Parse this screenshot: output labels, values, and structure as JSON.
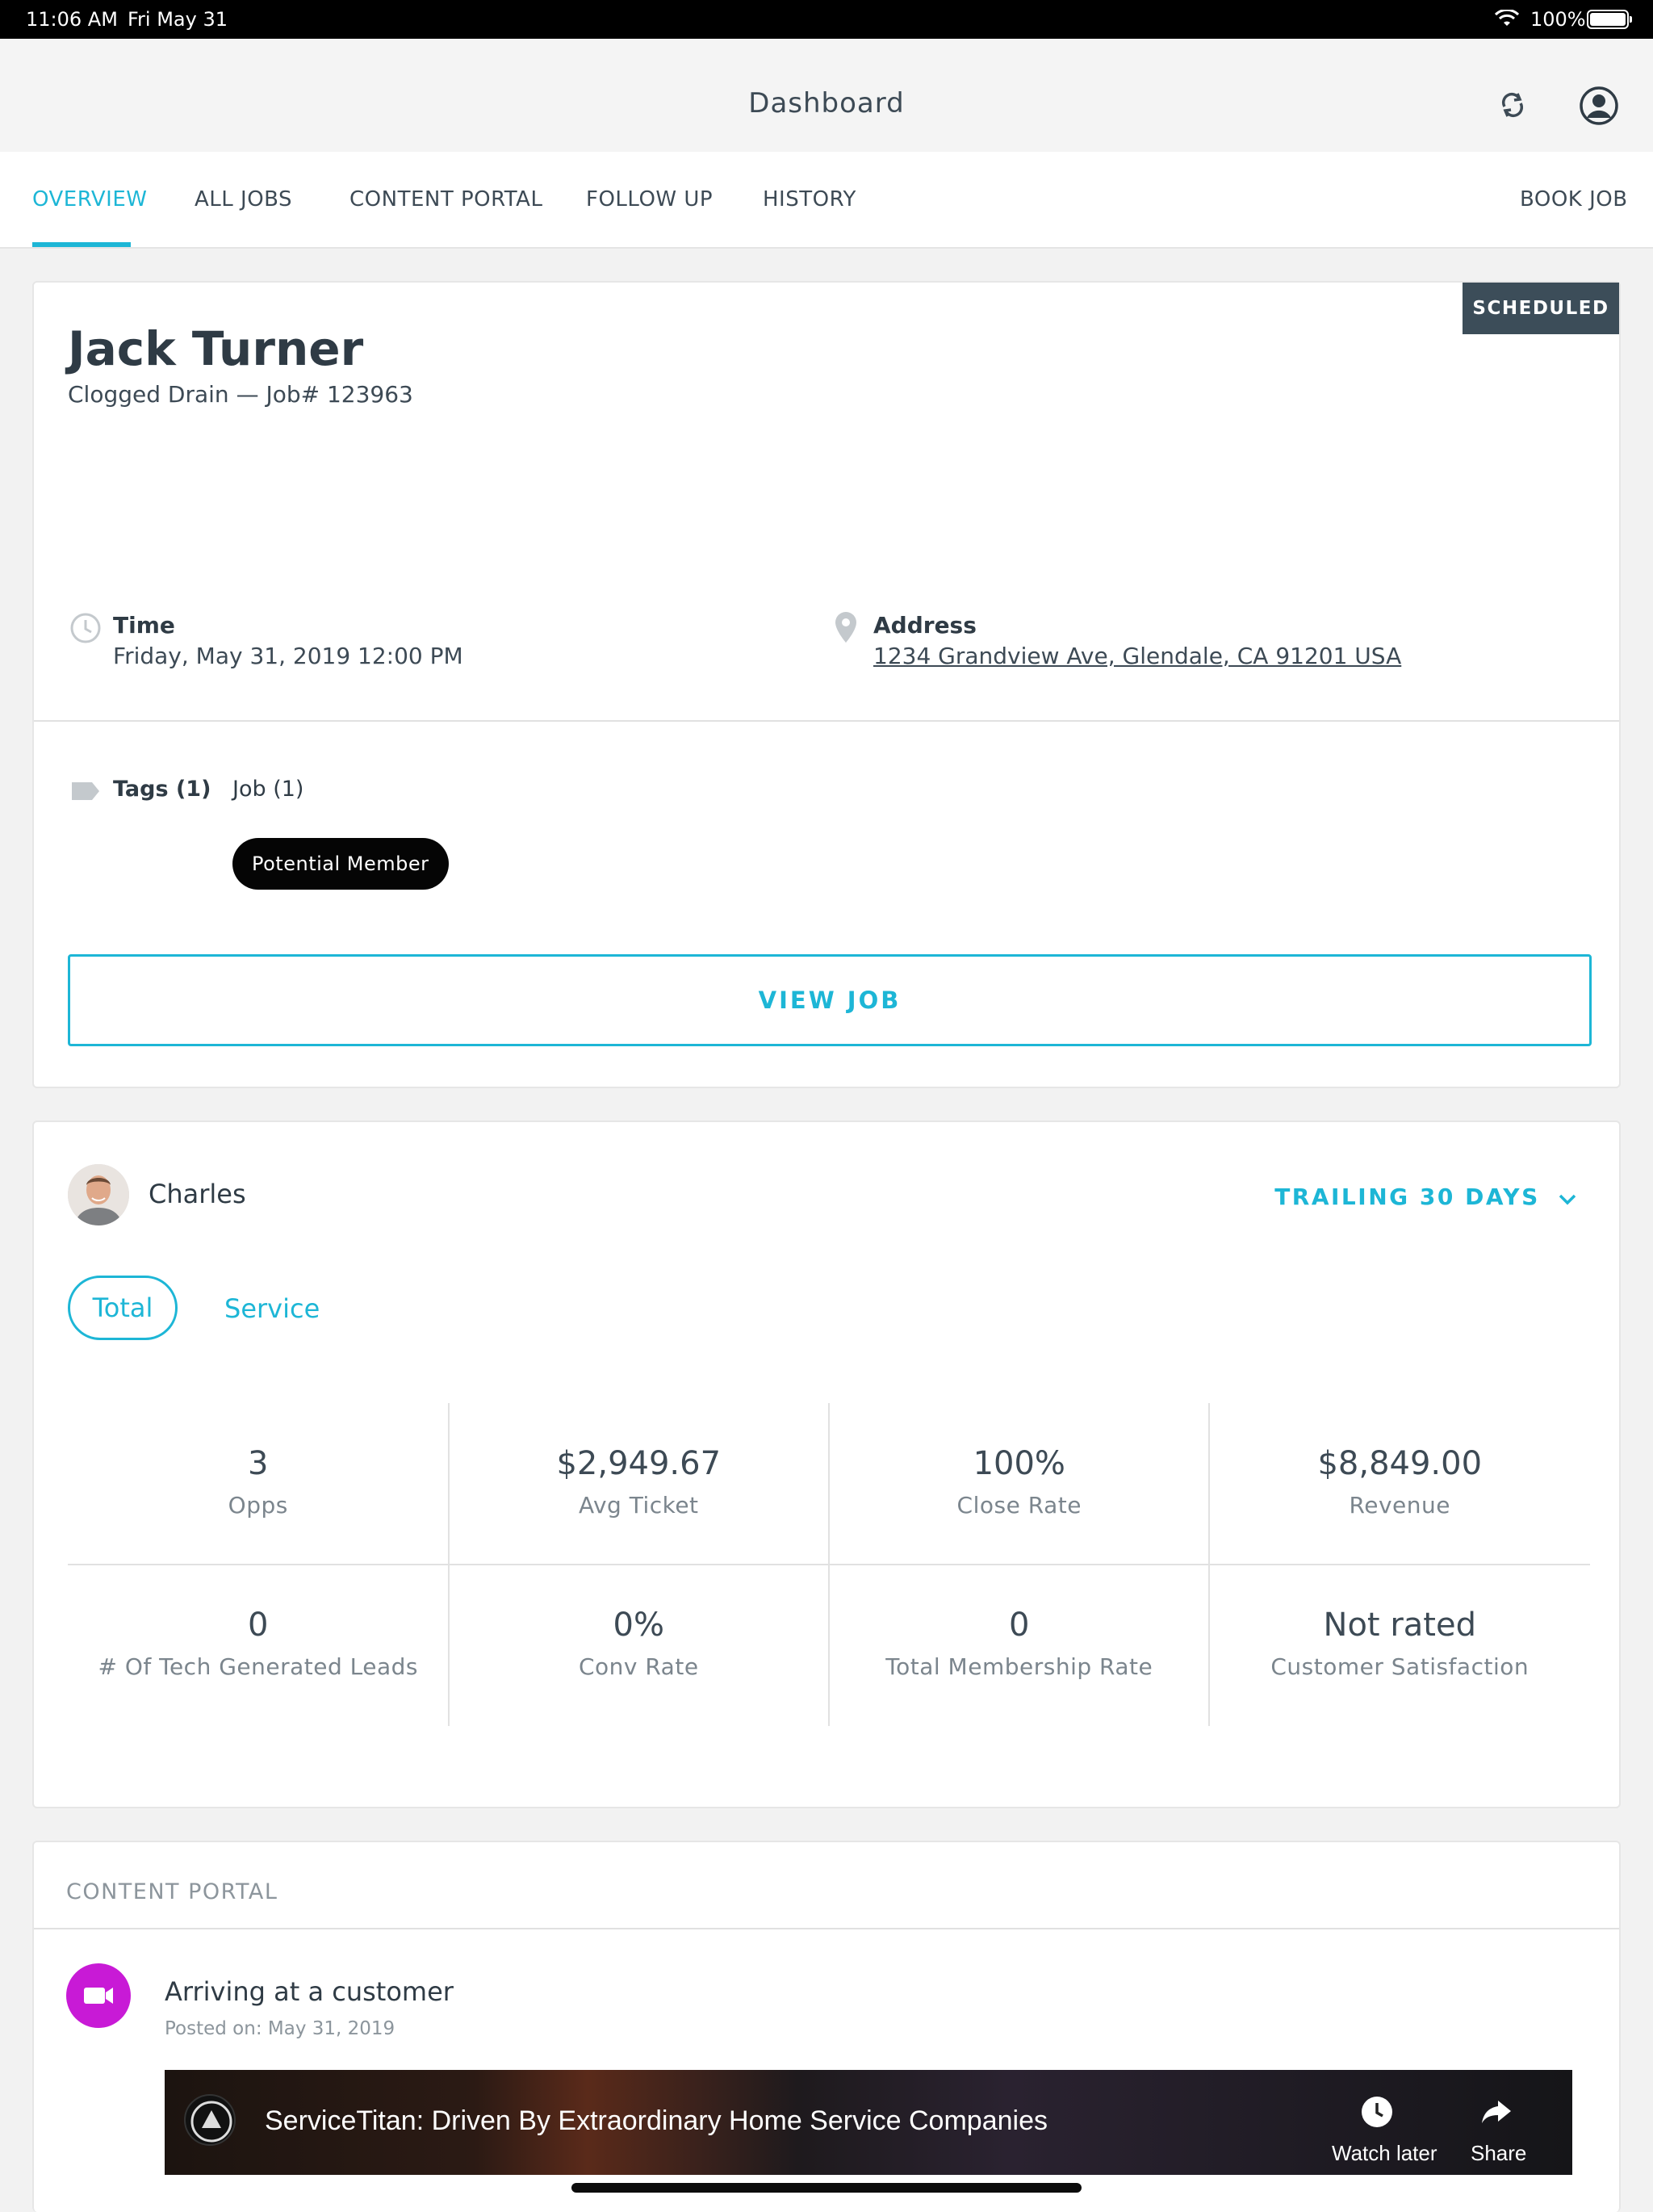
{
  "status_bar": {
    "time": "11:06 AM",
    "date": "Fri May 31",
    "battery": "100%"
  },
  "header": {
    "title": "Dashboard"
  },
  "tabs": [
    {
      "label": "OVERVIEW",
      "active": true
    },
    {
      "label": "ALL JOBS",
      "active": false
    },
    {
      "label": "CONTENT PORTAL",
      "active": false
    },
    {
      "label": "FOLLOW UP",
      "active": false
    },
    {
      "label": "HISTORY",
      "active": false
    }
  ],
  "book_job_label": "BOOK JOB",
  "job": {
    "status": "SCHEDULED",
    "customer_name": "Jack Turner",
    "subtitle": "Clogged Drain — Job# 123963",
    "time_label": "Time",
    "time_value": "Friday, May 31, 2019 12:00 PM",
    "address_label": "Address",
    "address_value": "1234 Grandview Ave, Glendale, CA 91201 USA",
    "tags_label": "Tags (1)",
    "job_tags_label": "Job (1)",
    "tag": "Potential Member",
    "view_job_label": "VIEW JOB"
  },
  "stats": {
    "tech_name": "Charles",
    "period": "TRAILING 30 DAYS",
    "segments": [
      "Total",
      "Service"
    ],
    "metrics": [
      {
        "value": "3",
        "label": "Opps"
      },
      {
        "value": "$2,949.67",
        "label": "Avg Ticket"
      },
      {
        "value": "100%",
        "label": "Close Rate"
      },
      {
        "value": "$8,849.00",
        "label": "Revenue"
      },
      {
        "value": "0",
        "label": "# Of Tech Generated Leads"
      },
      {
        "value": "0%",
        "label": "Conv Rate"
      },
      {
        "value": "0",
        "label": "Total Membership Rate"
      },
      {
        "value": "Not rated",
        "label": "Customer Satisfaction"
      }
    ]
  },
  "content_portal": {
    "header": "CONTENT PORTAL",
    "post_title": "Arriving at a customer",
    "post_date": "Posted on: May 31, 2019",
    "video_title": "ServiceTitan: Driven By Extraordinary Home Service Companies",
    "watch_later_label": "Watch later",
    "share_label": "Share"
  },
  "colors": {
    "accent": "#1db6d6",
    "badge": "#3c4d59",
    "video_badge": "#c81ad6"
  }
}
